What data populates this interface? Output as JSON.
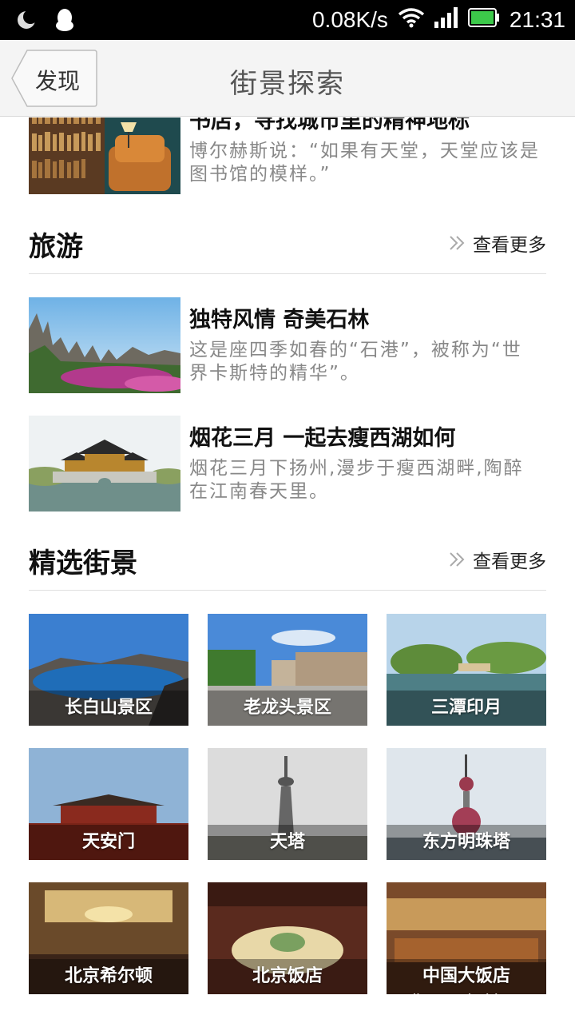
{
  "status_bar": {
    "speed": "0.08K/s",
    "time": "21:31",
    "colors": {
      "battery": "#3cc94a"
    }
  },
  "header": {
    "back_label": "发现",
    "title": "街景探索"
  },
  "articles_top": [
    {
      "title": "书店，寻找城市里的精神地标",
      "desc": "博尔赫斯说：“如果有天堂，天堂应该是图书馆的模样。”"
    }
  ],
  "travel": {
    "title": "旅游",
    "more": "查看更多",
    "items": [
      {
        "title": "独特风情 奇美石林",
        "desc": "这是座四季如春的“石港”，被称为“世界卡斯特的精华”。"
      },
      {
        "title": "烟花三月 一起去瘦西湖如何",
        "desc": "烟花三月下扬州,漫步于瘦西湖畔,陶醉在江南春天里。"
      }
    ]
  },
  "streetview": {
    "title": "精选街景",
    "more": "查看更多",
    "items": [
      {
        "label": "长白山景区"
      },
      {
        "label": "老龙头景区"
      },
      {
        "label": "三潭印月"
      },
      {
        "label": "天安门"
      },
      {
        "label": "天塔"
      },
      {
        "label": "东方明珠塔"
      },
      {
        "label": "北京希尔顿"
      },
      {
        "label": "北京饭店"
      },
      {
        "label": "中国大饭店"
      }
    ]
  },
  "watermark": "jingyan.baidu.com"
}
